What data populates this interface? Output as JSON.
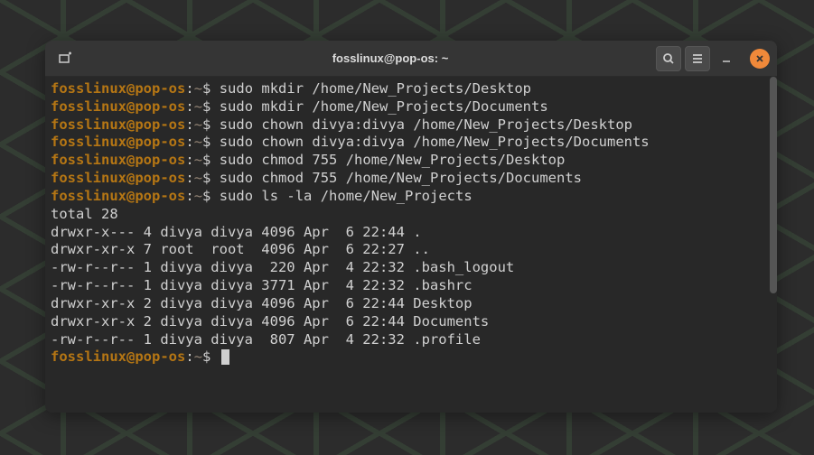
{
  "window": {
    "title": "fosslinux@pop-os: ~"
  },
  "prompt": {
    "user": "fosslinux",
    "host": "pop-os",
    "sep_at": "@",
    "colon": ":",
    "tilde": "~",
    "dollar": "$"
  },
  "commands": [
    "sudo mkdir /home/New_Projects/Desktop",
    "sudo mkdir /home/New_Projects/Documents",
    "sudo chown divya:divya /home/New_Projects/Desktop",
    "sudo chown divya:divya /home/New_Projects/Documents",
    "sudo chmod 755 /home/New_Projects/Desktop",
    "sudo chmod 755 /home/New_Projects/Documents",
    "sudo ls -la /home/New_Projects"
  ],
  "output": [
    "total 28",
    "drwxr-x--- 4 divya divya 4096 Apr  6 22:44 .",
    "drwxr-xr-x 7 root  root  4096 Apr  6 22:27 ..",
    "-rw-r--r-- 1 divya divya  220 Apr  4 22:32 .bash_logout",
    "-rw-r--r-- 1 divya divya 3771 Apr  4 22:32 .bashrc",
    "drwxr-xr-x 2 divya divya 4096 Apr  6 22:44 Desktop",
    "drwxr-xr-x 2 divya divya 4096 Apr  6 22:44 Documents",
    "-rw-r--r-- 1 divya divya  807 Apr  4 22:32 .profile"
  ]
}
